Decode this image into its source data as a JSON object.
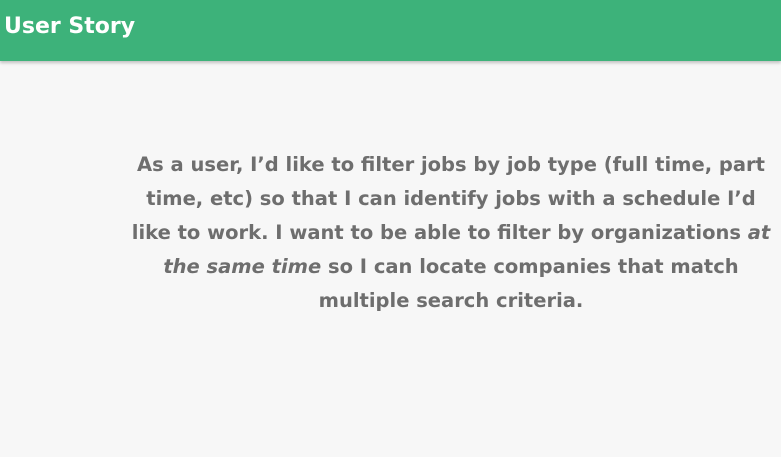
{
  "header": {
    "title": "User Story",
    "background_color": "#3db27a",
    "text_color": "#ffffff"
  },
  "story": {
    "text_before": "As a user, I’d like to filter jobs by job type (full time, part time, etc) so that I can identify jobs with a schedule I’d like to work. I want to be able to filter by organizations ",
    "emphasis": "at the same time",
    "text_after": " so I can locate companies that match multiple search criteria.",
    "text_color": "#6e6e6e"
  },
  "page": {
    "background_color": "#f7f7f7"
  }
}
